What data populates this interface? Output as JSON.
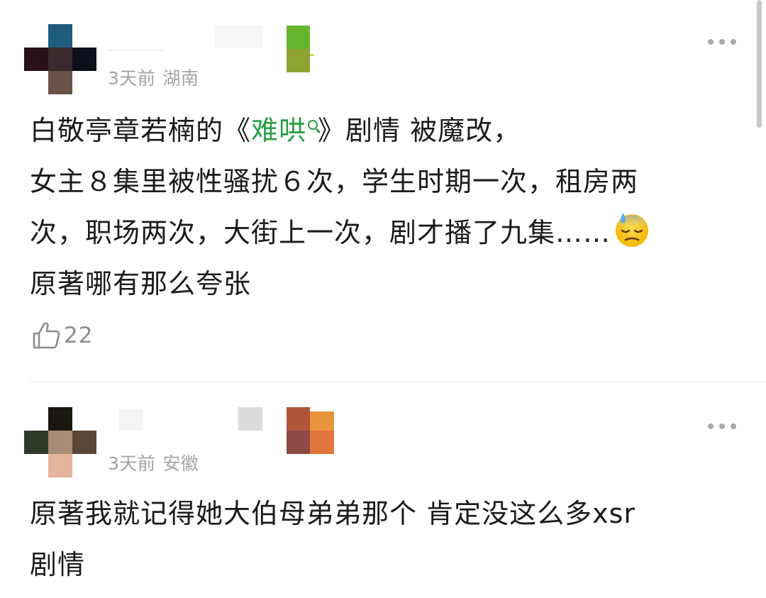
{
  "comments": [
    {
      "time": "3天前",
      "location": "湖南",
      "content_before_link": "白敬亭章若楠的《",
      "topic_link": "难哄",
      "content_after_link": "》剧情 被魔改，",
      "content_line2": "女主８集里被性骚扰６次，学生时期一次，租房两",
      "content_line3": "次，职场两次，大街上一次，剧才播了九集……",
      "content_line4": "原著哪有那么夸张",
      "likes": "22",
      "emoji_icon": "downcast-sweat-face-icon"
    },
    {
      "time": "3天前",
      "location": "安徽",
      "content_line1": "原著我就记得她大伯母弟弟那个 肯定没这么多xsr",
      "content_line2": "剧情"
    }
  ],
  "colors": {
    "link": "#2a9d46",
    "meta": "#a3a3a3",
    "text": "#1b1b1b",
    "like": "#8d8d8d"
  }
}
